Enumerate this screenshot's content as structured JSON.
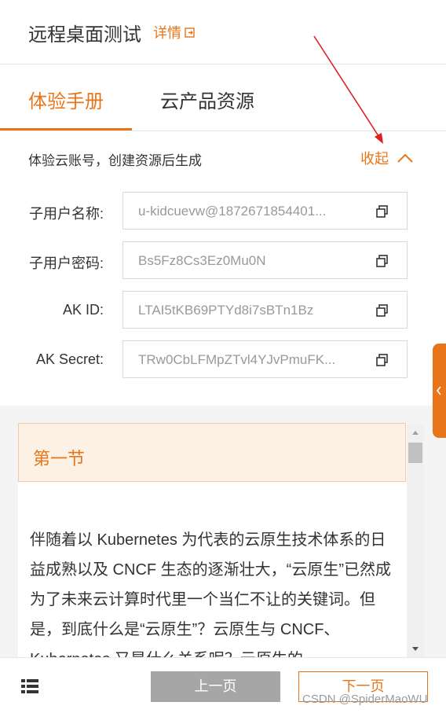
{
  "header": {
    "title": "远程桌面测试",
    "details_label": "详情"
  },
  "tabs": [
    {
      "label": "体验手册",
      "active": true
    },
    {
      "label": "云产品资源",
      "active": false
    }
  ],
  "account": {
    "label": "体验云账号，创建资源后生成",
    "collapse_label": "收起"
  },
  "credentials": [
    {
      "label": "子用户名称:",
      "value": "u-kidcuevw@1872671854401..."
    },
    {
      "label": "子用户密码:",
      "value": "Bs5Fz8Cs3Ez0Mu0N"
    },
    {
      "label": "AK ID:",
      "value": "LTAI5tKB69PTYd8i7sBTn1Bz"
    },
    {
      "label": "AK Secret:",
      "value": "TRw0CbLFMpZTvl4YJvPmuFK..."
    }
  ],
  "content": {
    "section_title": "第一节",
    "body": "伴随着以 Kubernetes 为代表的云原生技术体系的日益成熟以及 CNCF 生态的逐渐壮大，“云原生”已然成为了未来云计算时代里一个当仁不让的关键词。但是，到底什么是“云原生”？云原生与 CNCF、Kubernetes 又是什么关系呢？云原生的"
  },
  "footer": {
    "prev_label": "上一页",
    "next_label": "下一页",
    "watermark": "CSDN @SpiderMaoWU"
  },
  "colors": {
    "accent": "#e8751a",
    "annotation": "#e02020"
  },
  "icons": [
    "external-link-icon",
    "chevron-up-icon",
    "copy-icon",
    "chevron-left-icon",
    "list-icon"
  ]
}
